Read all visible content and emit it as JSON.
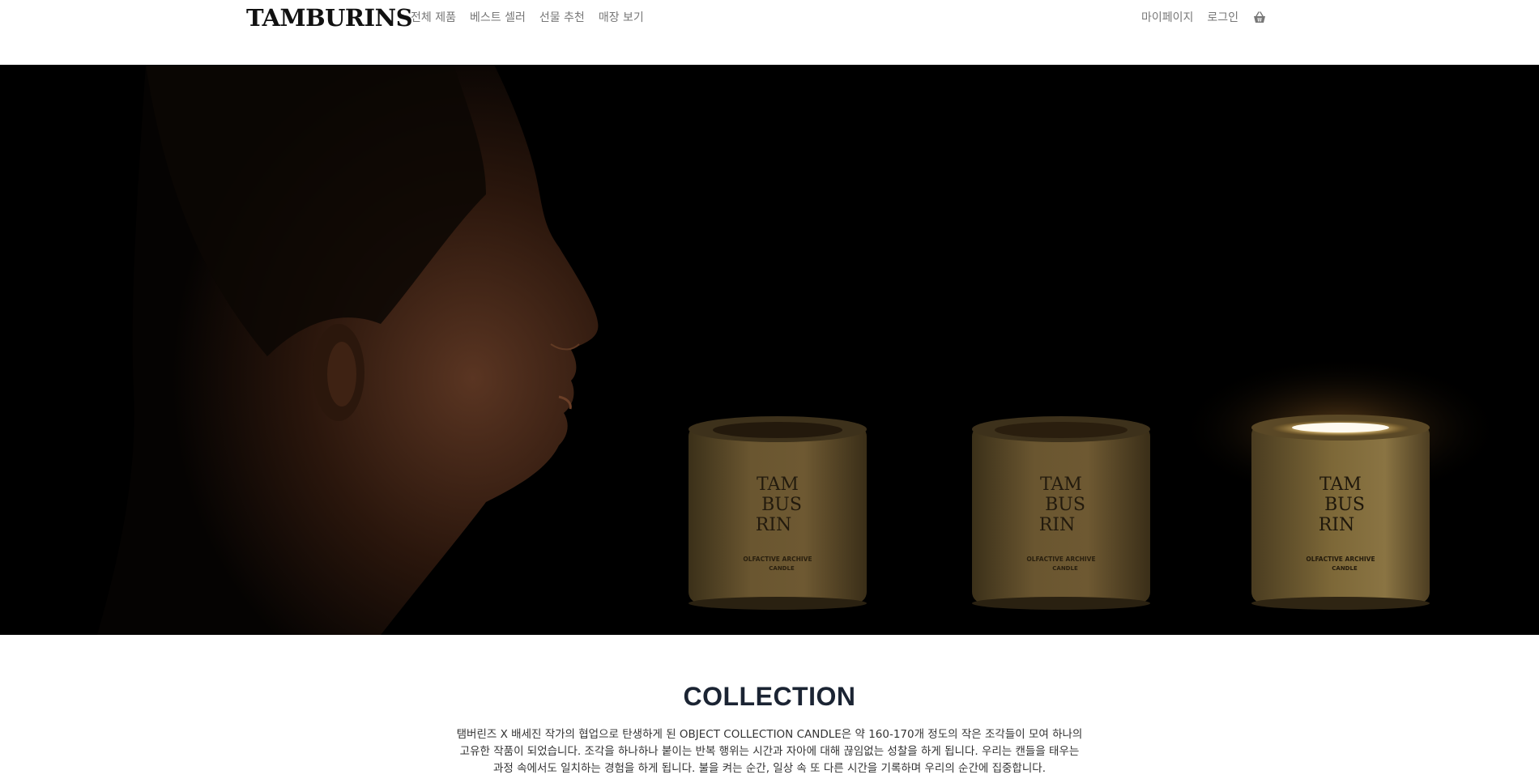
{
  "header": {
    "logo": "TAMBURINS",
    "nav_left": [
      {
        "label": "전체 제품"
      },
      {
        "label": "베스트 셀러"
      },
      {
        "label": "선물 추천"
      },
      {
        "label": "매장 보기"
      }
    ],
    "nav_right": [
      {
        "label": "마이페이지"
      },
      {
        "label": "로그인"
      }
    ],
    "cart_icon": "basket-icon"
  },
  "hero": {
    "candle_label_top": "TAM",
    "candle_label_mid": "BUS",
    "candle_label_bot": "RIN",
    "candle_label_sub": "OLFACTIVE ARCHIVE",
    "candle_label_sub2": "CANDLE"
  },
  "collection": {
    "title": "COLLECTION",
    "lines": [
      "탬버린즈 X 배세진 작가의 협업으로 탄생하게 된 OBJECT COLLECTION CANDLE은 약 160-170개 정도의 작은 조각들이 모여 하나의",
      "고유한 작품이 되었습니다. 조각을 하나하나 붙이는 반복 행위는 시간과 자아에 대해 끊임없는 성찰을 하게 됩니다. 우리는 캔들을 태우는",
      "과정 속에서도 일치하는 경험을 하게 됩니다. 불을 켜는 순간, 일상 속 또 다른 시간을 기록하며 우리의 순간에 집중합니다."
    ]
  },
  "colors": {
    "hero_background": "#000000",
    "title_color": "#1b2433",
    "nav_text": "#777777"
  }
}
